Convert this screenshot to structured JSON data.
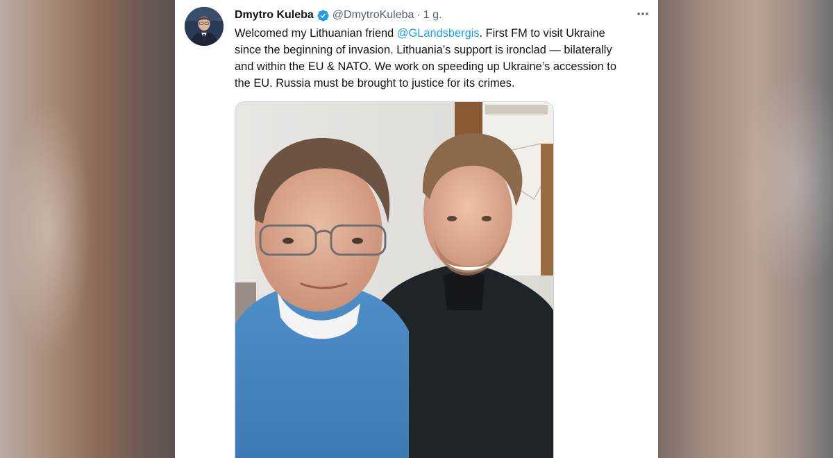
{
  "tweet": {
    "author_name": "Dmytro Kuleba",
    "handle": "@DmytroKuleba",
    "separator": "·",
    "time": "1 g.",
    "verified": true,
    "text_lines": [
      {
        "before": "Welcomed my Lithuanian friend ",
        "mention": "@GLandsbergis",
        "after": ". First FM to visit Ukraine"
      },
      {
        "text": "since the beginning of invasion. Lithuania’s support is ironclad — bilaterally"
      },
      {
        "text": "and within the EU & NATO. We work on speeding up Ukraine’s accession to"
      },
      {
        "text": "the EU. Russia must be brought to justice for its crimes."
      }
    ],
    "icons": {
      "verified": "verified-badge-icon",
      "more": "more-options-icon"
    }
  },
  "colors": {
    "accent": "#1d9bf0",
    "text": "#0f1419",
    "muted": "#536471"
  }
}
